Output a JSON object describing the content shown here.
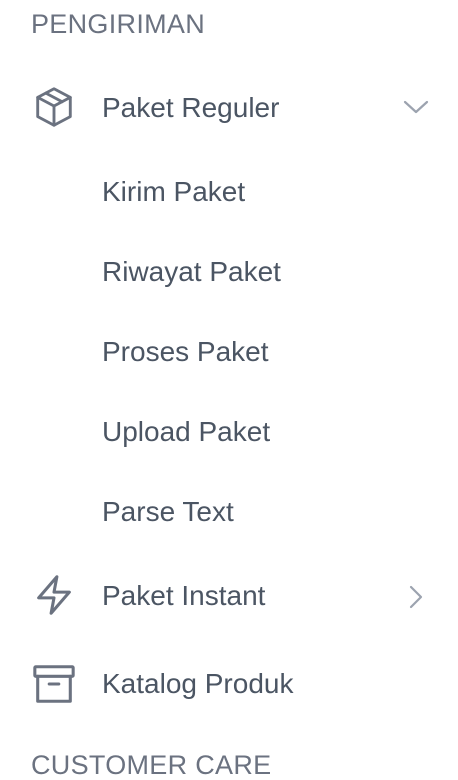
{
  "sections": {
    "shipping_heading": "PENGIRIMAN",
    "customer_care_heading": "CUSTOMER CARE"
  },
  "menu": {
    "paket_reguler": {
      "label": "Paket Reguler",
      "icon": "package-box-icon",
      "state": "expanded",
      "children": [
        {
          "label": "Kirim Paket"
        },
        {
          "label": "Riwayat Paket"
        },
        {
          "label": "Proses Paket"
        },
        {
          "label": "Upload Paket"
        },
        {
          "label": "Parse Text"
        }
      ]
    },
    "paket_instant": {
      "label": "Paket Instant",
      "icon": "lightning-bolt-icon",
      "state": "collapsed"
    },
    "katalog_produk": {
      "label": "Katalog Produk",
      "icon": "archive-box-icon"
    }
  },
  "colors": {
    "text": "#4b5563",
    "heading": "#6b7280",
    "chevron": "#9ca3af",
    "background": "#ffffff"
  }
}
